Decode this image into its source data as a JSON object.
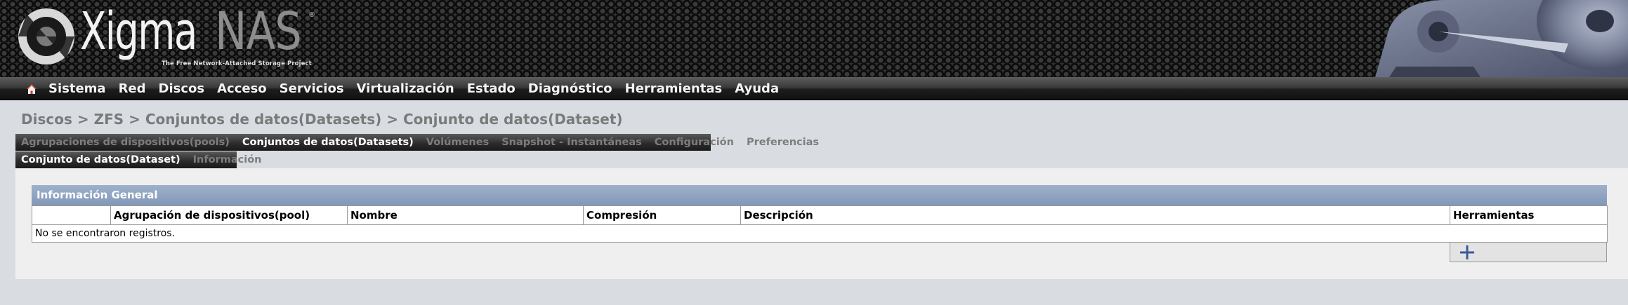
{
  "app": {
    "logo_text_main": "Xigma",
    "logo_text_accent": "NAS",
    "logo_registered": "®",
    "tagline": "The Free Network-Attached Storage Project"
  },
  "nav": {
    "home_icon": "home-icon",
    "items": [
      "Sistema",
      "Red",
      "Discos",
      "Acceso",
      "Servicios",
      "Virtualización",
      "Estado",
      "Diagnóstico",
      "Herramientas",
      "Ayuda"
    ]
  },
  "breadcrumb": {
    "parts": [
      "Discos",
      "ZFS",
      "Conjuntos de datos(Datasets)",
      "Conjunto de datos(Dataset)"
    ],
    "separator": ">"
  },
  "tabs_primary": [
    {
      "label": "Agrupaciones de dispositivos(pools)",
      "active": false
    },
    {
      "label": "Conjuntos de datos(Datasets)",
      "active": true
    },
    {
      "label": "Volúmenes",
      "active": false
    },
    {
      "label": "Snapshot - Instantáneas",
      "active": false
    },
    {
      "label": "Configuración",
      "active": false
    },
    {
      "label": "Preferencias",
      "active": false
    }
  ],
  "tabs_secondary": [
    {
      "label": "Conjunto de datos(Dataset)",
      "active": true
    },
    {
      "label": "Información",
      "active": false
    }
  ],
  "panel": {
    "title": "Información General",
    "columns": [
      "",
      "Agrupación de dispositivos(pool)",
      "Nombre",
      "Compresión",
      "Descripción",
      "Herramientas"
    ],
    "empty_message": "No se encontraron registros.",
    "add_icon": "plus-icon"
  },
  "colors": {
    "panel_header": "#8fa3c1",
    "page_background": "#d9dde2",
    "content_background": "#efefef",
    "add_icon_color": "#3b5a9a"
  }
}
